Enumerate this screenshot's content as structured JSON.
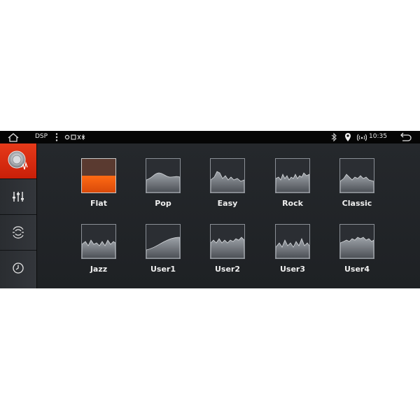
{
  "statusbar": {
    "title": "DSP",
    "time": "10:35"
  },
  "sidebar": {
    "items": [
      {
        "icon": "speaker-sound-icon",
        "active": true
      },
      {
        "icon": "equalizer-sliders-icon",
        "active": false
      },
      {
        "icon": "surround-field-icon",
        "active": false
      },
      {
        "icon": "clock-delay-icon",
        "active": false
      }
    ]
  },
  "presets": [
    {
      "label": "Flat",
      "selected": true
    },
    {
      "label": "Pop",
      "selected": false
    },
    {
      "label": "Easy",
      "selected": false
    },
    {
      "label": "Rock",
      "selected": false
    },
    {
      "label": "Classic",
      "selected": false
    },
    {
      "label": "Jazz",
      "selected": false
    },
    {
      "label": "User1",
      "selected": false
    },
    {
      "label": "User2",
      "selected": false
    },
    {
      "label": "User3",
      "selected": false
    },
    {
      "label": "User4",
      "selected": false
    }
  ],
  "colors": {
    "accent": "#e63a1a",
    "background": "#1f2226",
    "statusbar": "#050505"
  }
}
